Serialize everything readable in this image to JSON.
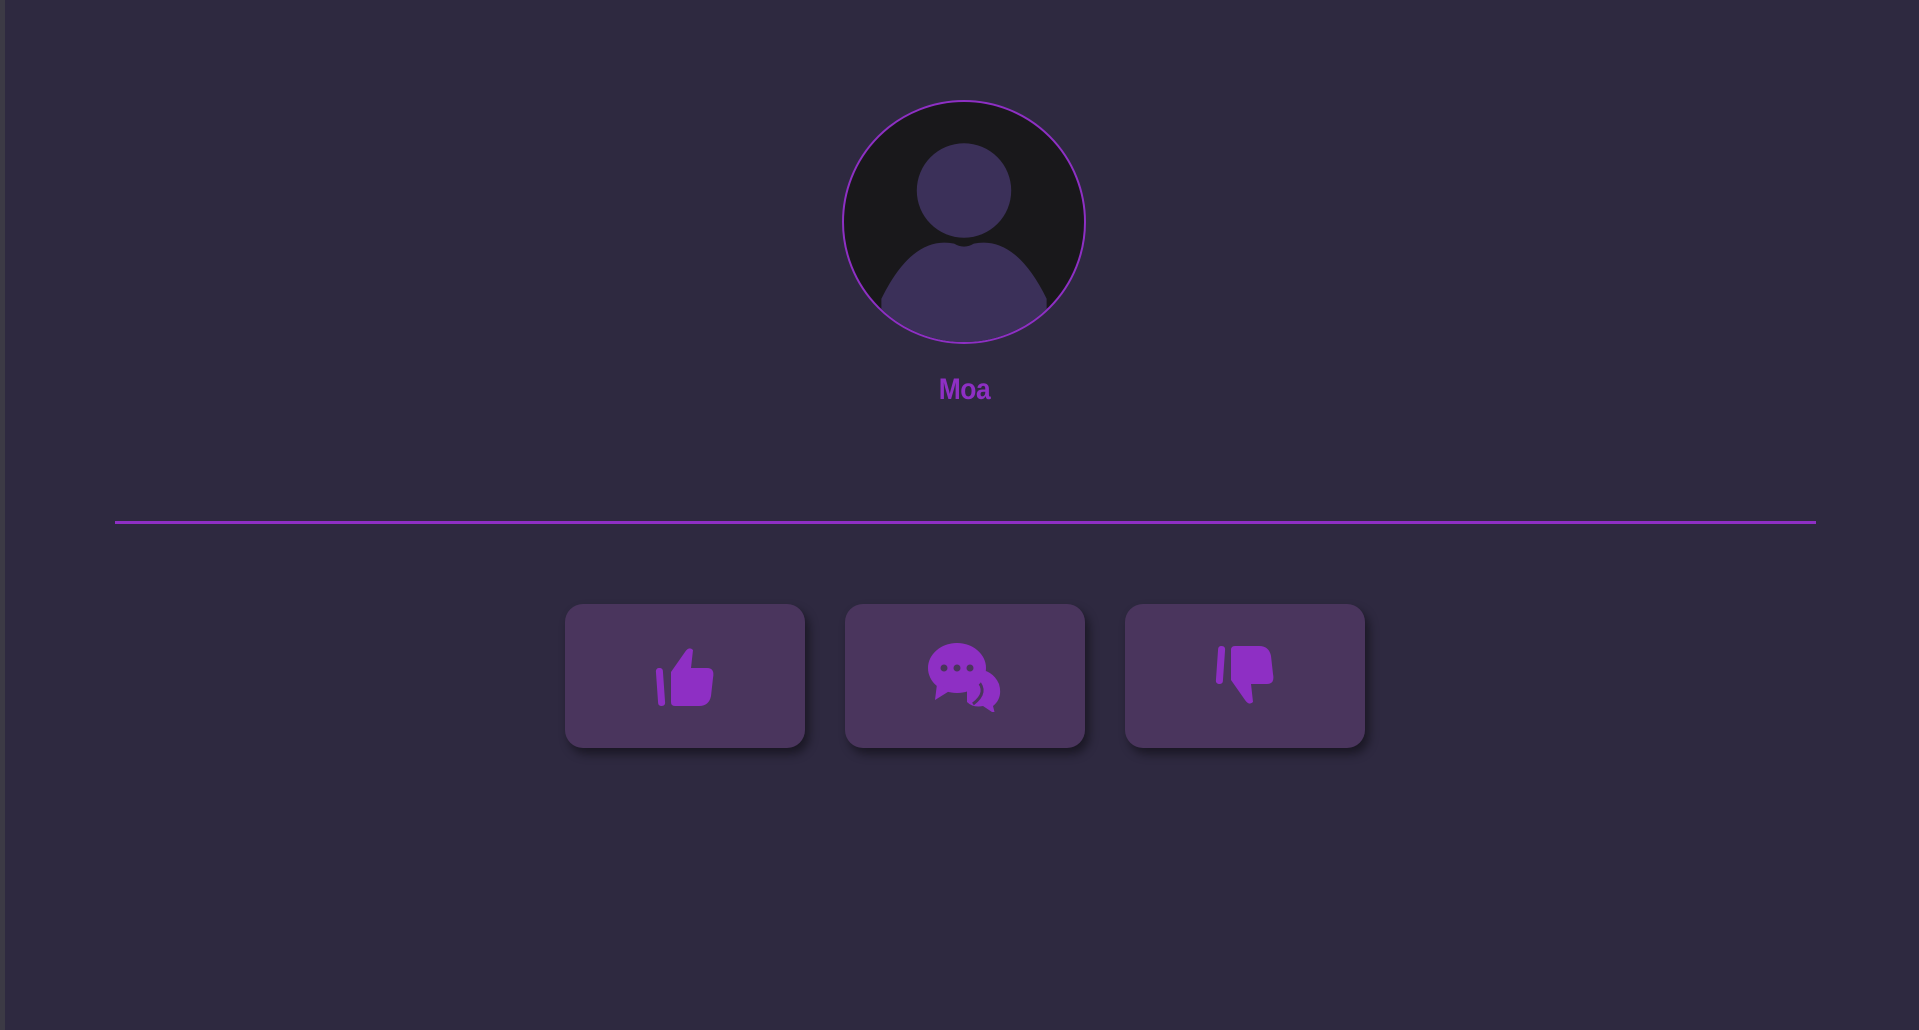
{
  "profile": {
    "username": "Moa",
    "avatar_icon": "default-user-silhouette"
  },
  "actions": [
    {
      "name": "like",
      "icon": "thumbs-up-icon"
    },
    {
      "name": "chat",
      "icon": "chat-bubbles-icon"
    },
    {
      "name": "dislike",
      "icon": "thumbs-down-icon"
    }
  ],
  "colors": {
    "background": "#2e2940",
    "accent": "#8e2fc4",
    "button_bg": "#4a355d",
    "avatar_bg": "#19181b",
    "avatar_figure": "#3b3059"
  }
}
